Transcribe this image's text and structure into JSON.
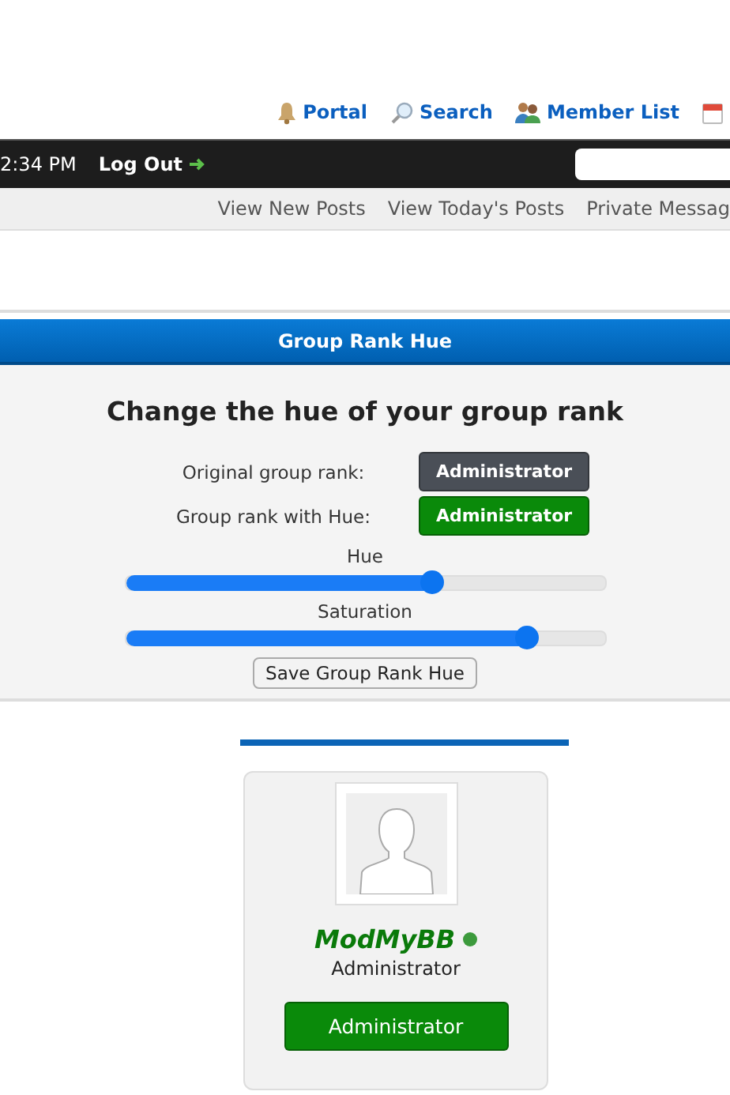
{
  "top_links": [
    {
      "label": "Portal",
      "kind": "bell"
    },
    {
      "label": "Search",
      "kind": "search"
    },
    {
      "label": "Member List",
      "kind": "members"
    },
    {
      "kind": "calendar"
    }
  ],
  "user_bar": {
    "time": "2:34 PM",
    "logout": "Log Out"
  },
  "nav_links": [
    "View New Posts",
    "View Today's Posts",
    "Private Messag"
  ],
  "panel": {
    "title": "Group Rank Hue",
    "heading": "Change the hue of your group rank",
    "ranks": [
      {
        "label": "Original group rank:",
        "badge": "Administrator",
        "color": "#4a4f57"
      },
      {
        "label": "Group rank with Hue:",
        "badge": "Administrator",
        "color": "#0a8a0a"
      }
    ],
    "sliders": [
      {
        "label": "Hue",
        "level": 0.64
      },
      {
        "label": "Saturation",
        "level": 0.835
      }
    ],
    "save_button": "Save Group Rank Hue"
  },
  "profile": {
    "username": "ModMyBB",
    "online": true,
    "title": "Administrator",
    "badge": "Administrator"
  }
}
